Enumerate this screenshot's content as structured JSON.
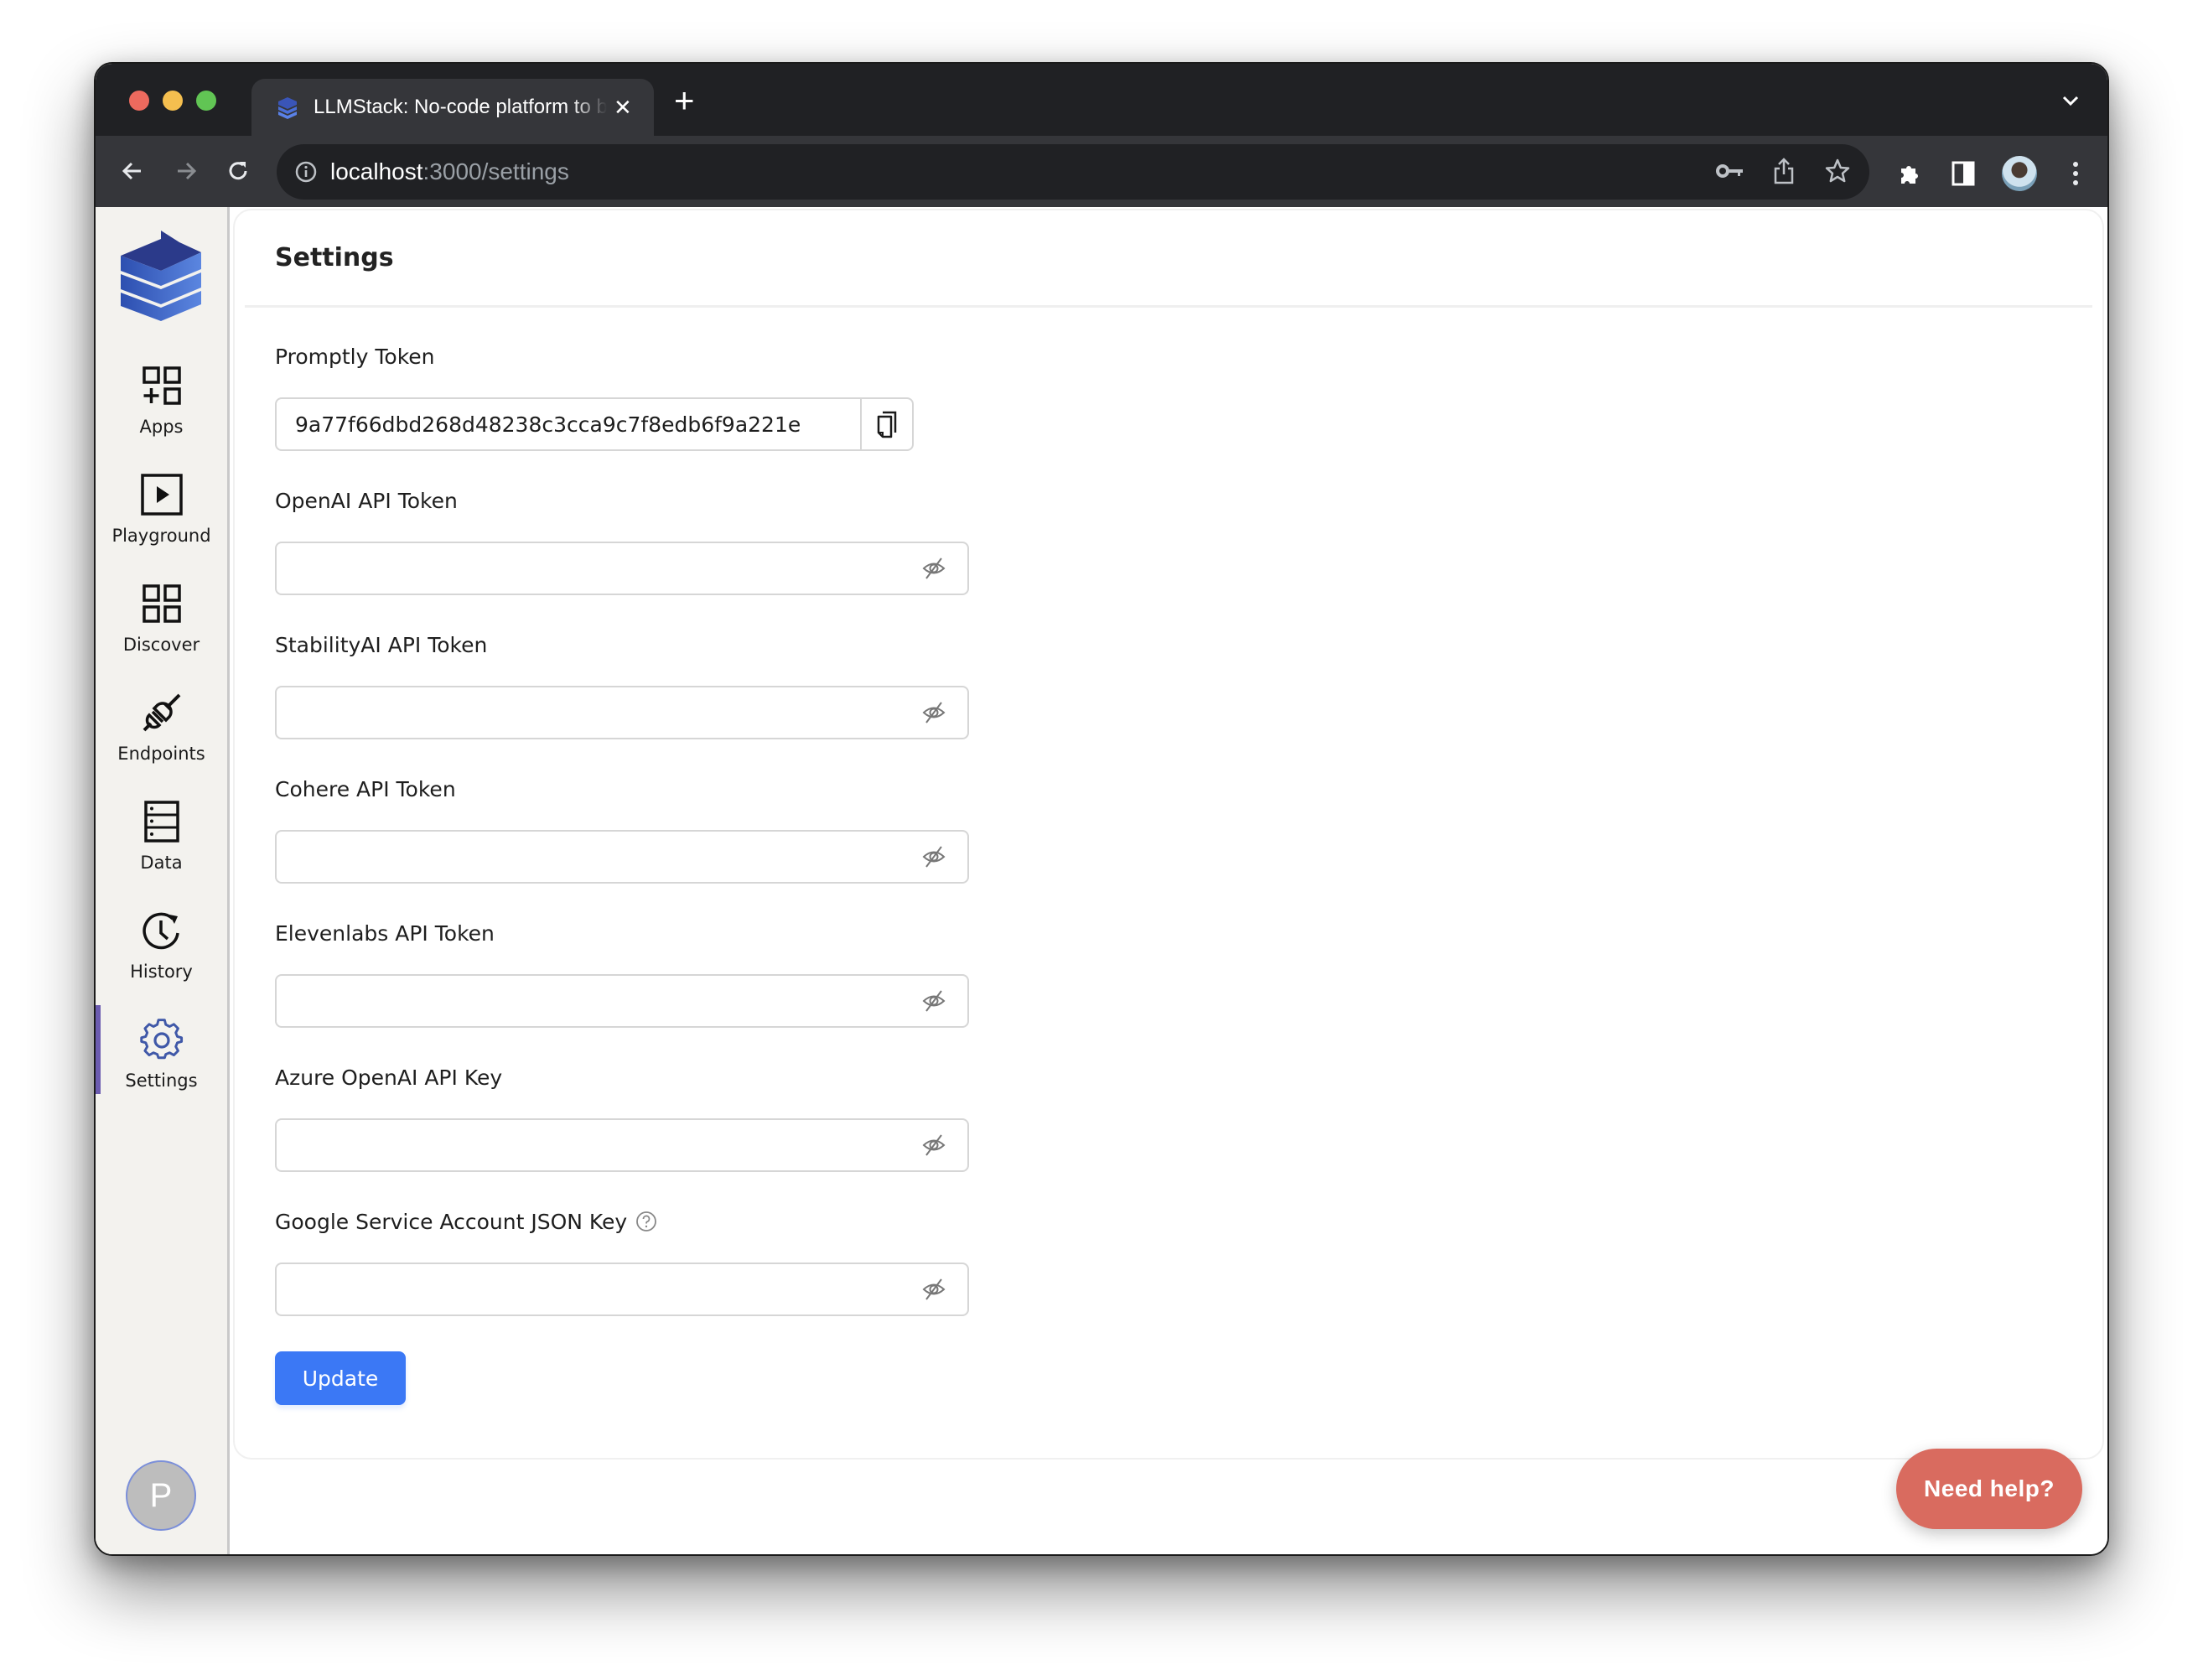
{
  "browser": {
    "tab_title": "LLMStack: No-code platform to build generative AI apps",
    "url_host": "localhost",
    "url_path": ":3000/settings",
    "icons": [
      "back-icon",
      "forward-icon",
      "reload-icon",
      "site-info-icon",
      "password-key-icon",
      "share-icon",
      "bookmark-star-icon",
      "extensions-icon",
      "side-panel-icon",
      "profile-avatar",
      "menu-kebab-icon",
      "tab-dropdown-icon"
    ]
  },
  "sidebar": {
    "items": [
      {
        "label": "Apps",
        "icon": "apps-add-icon"
      },
      {
        "label": "Playground",
        "icon": "play-box-icon"
      },
      {
        "label": "Discover",
        "icon": "grid-icon"
      },
      {
        "label": "Endpoints",
        "icon": "plug-icon"
      },
      {
        "label": "Data",
        "icon": "server-icon"
      },
      {
        "label": "History",
        "icon": "history-clock-icon"
      },
      {
        "label": "Settings",
        "icon": "gear-icon",
        "active": true
      }
    ],
    "avatar_initial": "P",
    "active_color": "#6b5bb0"
  },
  "settings": {
    "title": "Settings",
    "promptly_token": {
      "label": "Promptly Token",
      "value": "9a77f66dbd268d48238c3cca9c7f8edb6f9a221e"
    },
    "fields": [
      {
        "label": "OpenAI API Token",
        "value": ""
      },
      {
        "label": "StabilityAI API Token",
        "value": ""
      },
      {
        "label": "Cohere API Token",
        "value": ""
      },
      {
        "label": "Elevenlabs API Token",
        "value": ""
      },
      {
        "label": "Azure OpenAI API Key",
        "value": ""
      },
      {
        "label": "Google Service Account JSON Key",
        "value": "",
        "has_help": true
      }
    ],
    "update_label": "Update",
    "accent_color": "#3b78f5"
  },
  "help_widget": {
    "label": "Need help?",
    "color": "#d96b5f"
  }
}
